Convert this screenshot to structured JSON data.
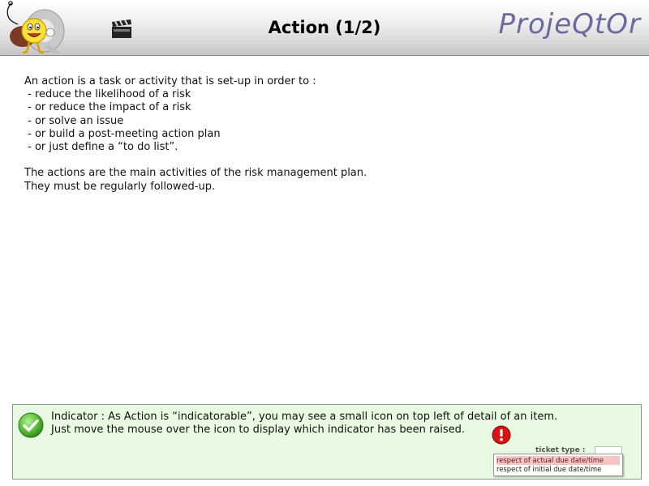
{
  "header": {
    "title": "Action (1/2)",
    "brand": "ProjeQtOr"
  },
  "intro": {
    "lines": [
      "An action is a task or activity that is set-up in order to :",
      " - reduce the likelihood of a risk",
      " - or reduce the impact of a risk",
      " - or solve an issue",
      " - or build a post-meeting action plan",
      " - or just define a “to do list”."
    ],
    "lines2": [
      "The actions are the main activities of the risk management plan.",
      "They must be regularly followed-up."
    ]
  },
  "indicator": {
    "lines": [
      "Indicator : As Action is “indicatorable”, you may see a small icon on top left of detail of an item.",
      "Just move the mouse over the icon to display which indicator has been raised."
    ],
    "tooltip": {
      "field_label": "ticket type :",
      "items": [
        "respect of actual due date/time",
        "respect of initial due date/time"
      ]
    }
  },
  "colors": {
    "brand": "#6b6aa0",
    "indicator_bg": "#e8fae1",
    "alert_row": "#f6c6c6"
  },
  "icons": [
    "projeqtor-logo",
    "clapperboard-icon",
    "check-icon",
    "exclamation-icon"
  ]
}
